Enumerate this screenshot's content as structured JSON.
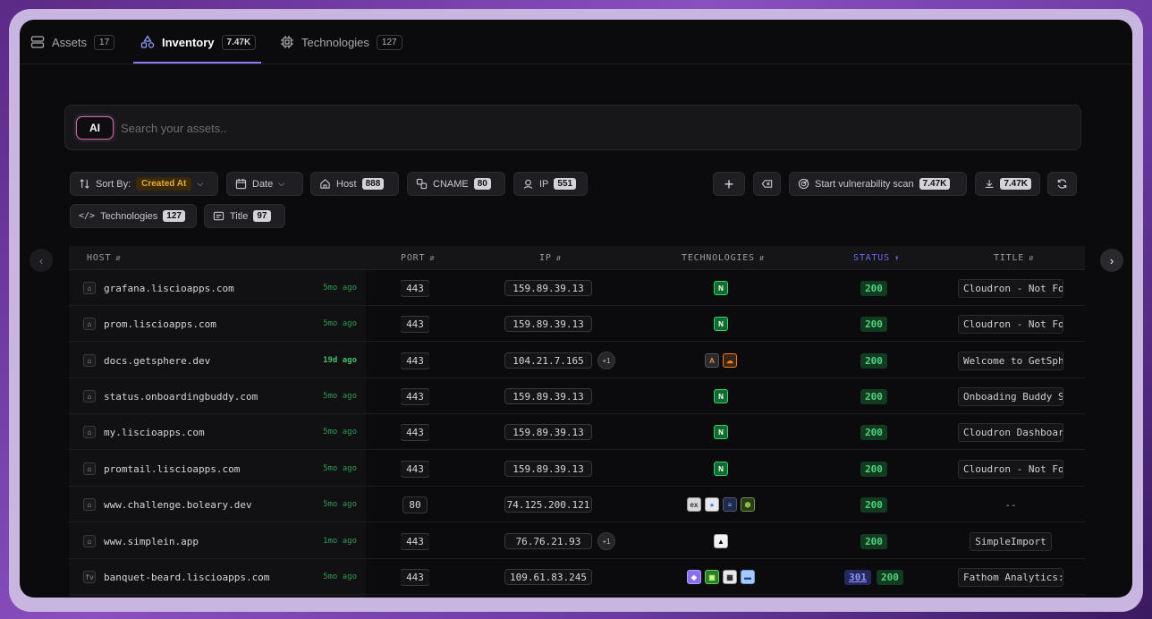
{
  "tabs": [
    {
      "label": "Assets",
      "count": "17"
    },
    {
      "label": "Inventory",
      "count": "7.47K"
    },
    {
      "label": "Technologies",
      "count": "127"
    }
  ],
  "search": {
    "ai_label": "AI",
    "placeholder": "Search your assets.."
  },
  "filters": {
    "sort_label": "Sort By:",
    "sort_value": "Created At",
    "date_label": "Date",
    "host_label": "Host",
    "host_count": "888",
    "cname_label": "CNAME",
    "cname_count": "80",
    "ip_label": "IP",
    "ip_count": "551",
    "technologies_label": "Technologies",
    "technologies_count": "127",
    "title_label": "Title",
    "title_count": "97",
    "scan_label": "Start vulnerability scan",
    "scan_count": "7.47K",
    "export_count": "7.47K"
  },
  "columns": {
    "host": "HOST",
    "port": "PORT",
    "ip": "IP",
    "technologies": "TECHNOLOGIES",
    "status": "STATUS",
    "title": "TITLE"
  },
  "rows": [
    {
      "host": "grafana.liscioapps.com",
      "ago": "5mo ago",
      "port": "443",
      "ip": "159.89.39.13",
      "extra": "",
      "tech": [
        "nginx"
      ],
      "status": [
        "200"
      ],
      "title": "Cloudron - Not Found"
    },
    {
      "host": "prom.liscioapps.com",
      "ago": "5mo ago",
      "port": "443",
      "ip": "159.89.39.13",
      "extra": "",
      "tech": [
        "nginx"
      ],
      "status": [
        "200"
      ],
      "title": "Cloudron - Not Found"
    },
    {
      "host": "docs.getsphere.dev",
      "ago": "19d ago",
      "port": "443",
      "ip": "104.21.7.165",
      "extra": "+1",
      "tech": [
        "astro",
        "cloudflare"
      ],
      "status": [
        "200"
      ],
      "title": "Welcome to GetSphere"
    },
    {
      "host": "status.onboardingbuddy.com",
      "ago": "5mo ago",
      "port": "443",
      "ip": "159.89.39.13",
      "extra": "",
      "tech": [
        "nginx"
      ],
      "status": [
        "200"
      ],
      "title": "Onboading Buddy Status"
    },
    {
      "host": "my.liscioapps.com",
      "ago": "5mo ago",
      "port": "443",
      "ip": "159.89.39.13",
      "extra": "",
      "tech": [
        "nginx"
      ],
      "status": [
        "200"
      ],
      "title": "Cloudron Dashboard"
    },
    {
      "host": "promtail.liscioapps.com",
      "ago": "5mo ago",
      "port": "443",
      "ip": "159.89.39.13",
      "extra": "",
      "tech": [
        "nginx"
      ],
      "status": [
        "200"
      ],
      "title": "Cloudron - Not Found"
    },
    {
      "host": "www.challenge.boleary.dev",
      "ago": "5mo ago",
      "port": "80",
      "ip": "74.125.200.121",
      "extra": "",
      "tech": [
        "express",
        "google-cloud",
        "stack",
        "nodejs"
      ],
      "status": [
        "200"
      ],
      "title": "--"
    },
    {
      "host": "www.simplein.app",
      "ago": "1mo ago",
      "port": "443",
      "ip": "76.76.21.93",
      "extra": "+1",
      "tech": [
        "vercel"
      ],
      "status": [
        "200"
      ],
      "title": "SimpleImport"
    },
    {
      "host": "banquet-beard.liscioapps.com",
      "ago": "5mo ago",
      "port": "443",
      "ip": "109.61.83.245",
      "extra": "",
      "tech": [
        "purple",
        "green",
        "dark",
        "blue"
      ],
      "status": [
        "301",
        "200"
      ],
      "title": "Fathom Analytics: A"
    }
  ],
  "colors": {
    "accent": "#8b7cf6",
    "status_ok": "#4fd47c",
    "sort_highlight": "#e8a83a"
  }
}
